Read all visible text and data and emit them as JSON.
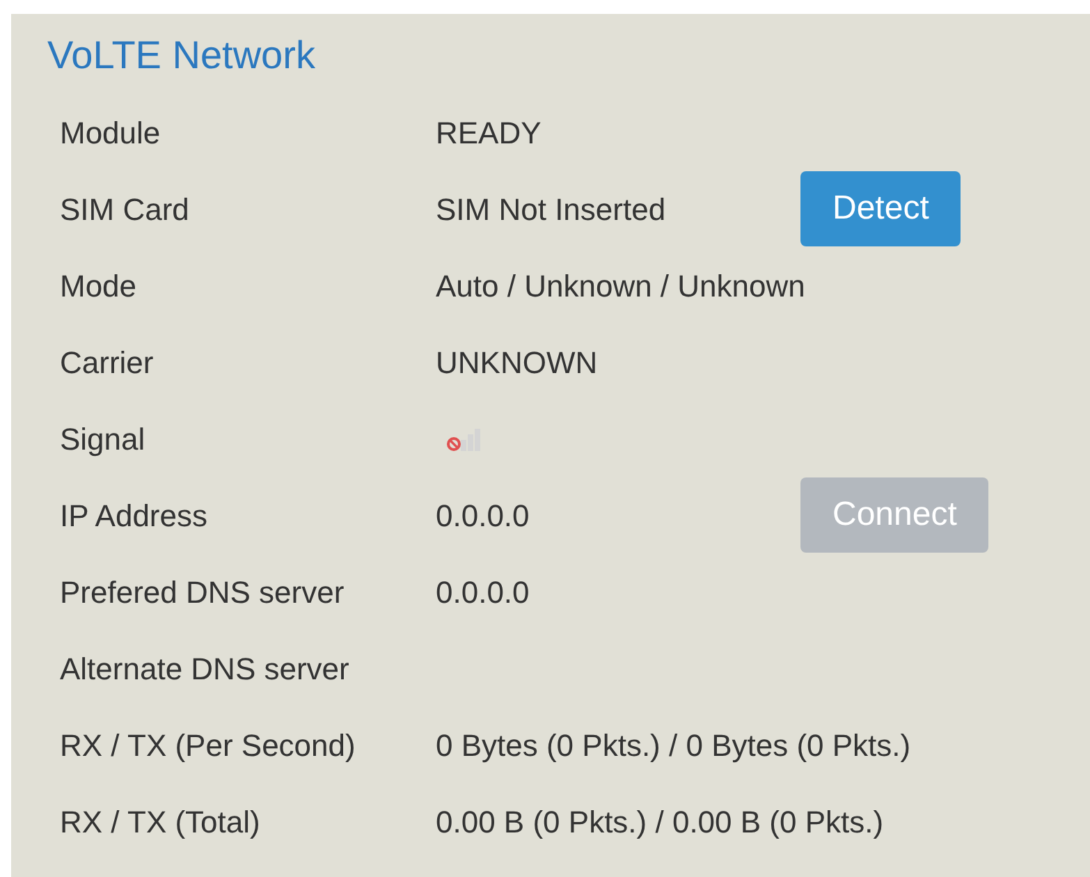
{
  "title": "VoLTE Network",
  "rows": [
    {
      "kind": "text",
      "label": "Module",
      "value": "READY"
    },
    {
      "kind": "text",
      "label": "SIM Card",
      "value": "SIM Not Inserted",
      "button": {
        "label": "Detect",
        "disabled": false
      }
    },
    {
      "kind": "text",
      "label": "Mode",
      "value": "Auto / Unknown / Unknown"
    },
    {
      "kind": "text",
      "label": "Carrier",
      "value": "UNKNOWN"
    },
    {
      "kind": "signal",
      "label": "Signal"
    },
    {
      "kind": "text",
      "label": "IP Address",
      "value": "0.0.0.0",
      "button": {
        "label": "Connect",
        "disabled": true
      }
    },
    {
      "kind": "text",
      "label": "Prefered DNS server",
      "value": "0.0.0.0"
    },
    {
      "kind": "text",
      "label": "Alternate DNS server"
    },
    {
      "kind": "text",
      "label": "RX / TX (Per Second)",
      "value": "0 Bytes (0 Pkts.) / 0 Bytes (0 Pkts.)"
    },
    {
      "kind": "text",
      "label": "RX / TX (Total)",
      "value": "0.00 B (0 Pkts.) / 0.00 B (0 Pkts.)"
    }
  ]
}
